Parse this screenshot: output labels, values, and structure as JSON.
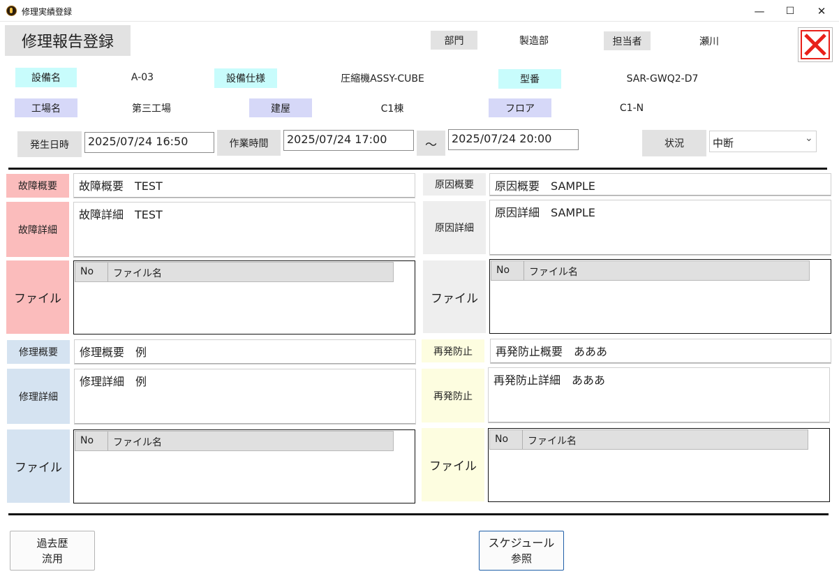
{
  "window": {
    "title": "修理実績登録",
    "minimize_glyph": "—",
    "maximize_glyph": "☐",
    "close_glyph": "✕"
  },
  "header": {
    "page_title": "修理報告登録",
    "dept_label": "部門",
    "dept_value": "製造部",
    "person_label": "担当者",
    "person_value": "瀬川",
    "close_color": "#e8201a"
  },
  "equipment": {
    "name_label": "設備名",
    "name_value": "A-03",
    "spec_label": "設備仕様",
    "spec_value": "圧縮機ASSY-CUBE",
    "model_label": "型番",
    "model_value": "SAR-GWQ2-D7",
    "factory_label": "工場名",
    "factory_value": "第三工場",
    "building_label": "建屋",
    "building_value": "C1棟",
    "floor_label": "フロア",
    "floor_value": "C1-N"
  },
  "timing": {
    "occur_label": "発生日時",
    "occur_value": "2025/07/24 16:50",
    "work_label": "作業時間",
    "work_start": "2025/07/24 17:00",
    "tilde": "～",
    "work_end": "2025/07/24 20:00",
    "status_label": "状況",
    "status_value": "中断",
    "chevron": "⌄"
  },
  "failure": {
    "summary_label": "故障概要",
    "summary_value": "故障概要　TEST",
    "detail_label": "故障詳細",
    "detail_value": "故障詳細　TEST",
    "file_label": "ファイル"
  },
  "cause": {
    "summary_label": "原因概要",
    "summary_value": "原因概要　SAMPLE",
    "detail_label": "原因詳細",
    "detail_value": "原因詳細　SAMPLE",
    "file_label": "ファイル"
  },
  "repair": {
    "summary_label": "修理概要",
    "summary_value": "修理概要　例",
    "detail_label": "修理詳細",
    "detail_value": "修理詳細　例",
    "file_label": "ファイル"
  },
  "prevention": {
    "summary_label": "再発防止",
    "summary_value": "再発防止概要　あああ",
    "detail_label": "再発防止",
    "detail_value": "再発防止詳細　あああ",
    "file_label": "ファイル"
  },
  "file_grid": {
    "col_no": "No",
    "col_name": "ファイル名"
  },
  "footer": {
    "history_line1": "過去歴",
    "history_line2": "流用",
    "schedule_line1": "スケジュール",
    "schedule_line2": "参照"
  }
}
